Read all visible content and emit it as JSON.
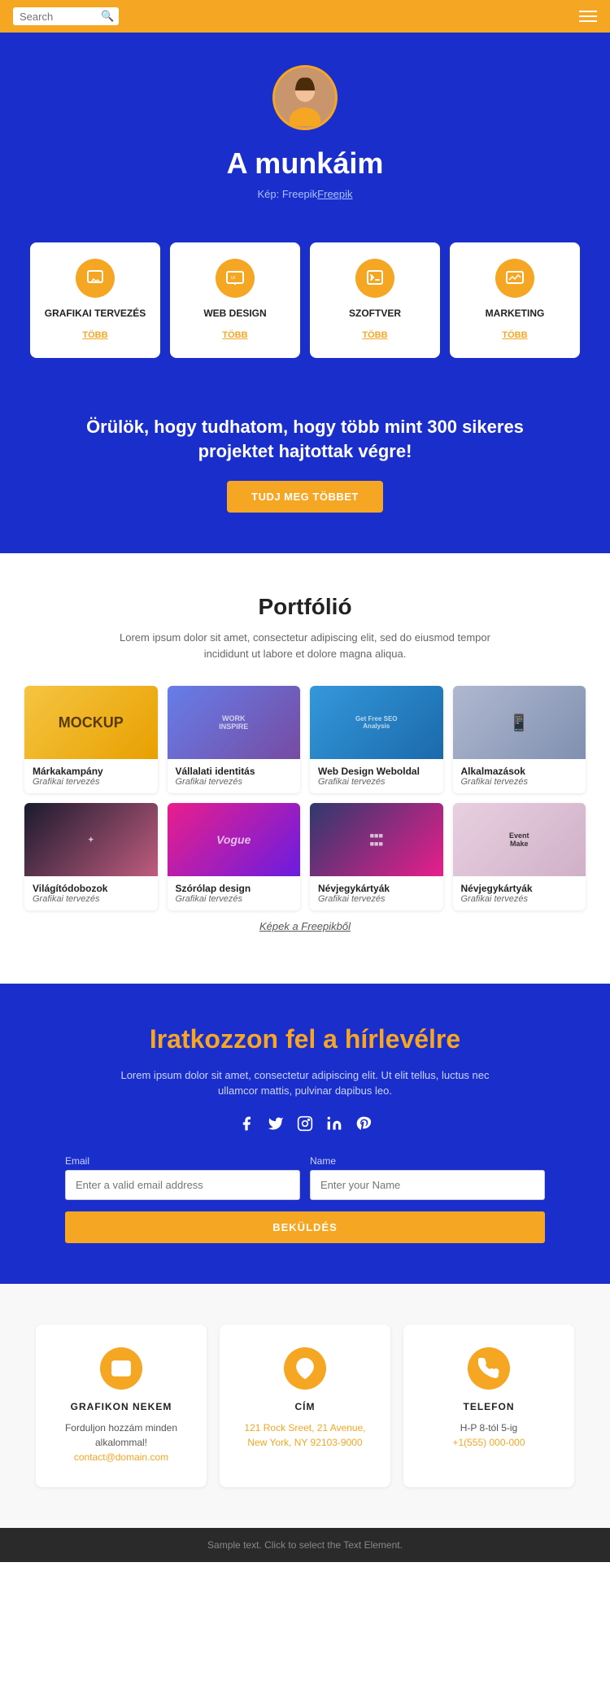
{
  "header": {
    "search_placeholder": "Search",
    "menu_label": "Menu"
  },
  "hero": {
    "title": "A munkáim",
    "image_credit": "Kép: Freepik",
    "image_credit_link": "Freepik"
  },
  "services": [
    {
      "id": "grafikai",
      "title": "GRAFIKAI TERVEZÉS",
      "more": "TÖBB"
    },
    {
      "id": "web",
      "title": "WEB DESIGN",
      "more": "TÖBB"
    },
    {
      "id": "szoftver",
      "title": "SZOFTVER",
      "more": "TÖBB"
    },
    {
      "id": "marketing",
      "title": "MARKETING",
      "more": "TÖBB"
    }
  ],
  "cta": {
    "text": "Örülök, hogy tudhatom, hogy több mint 300 sikeres projektet hajtottak végre!",
    "button_label": "TUDJ MEG TÖBBET"
  },
  "portfolio": {
    "title": "Portfólió",
    "description": "Lorem ipsum dolor sit amet, consectetur adipiscing elit, sed do eiusmod tempor incididunt ut labore et dolore magna aliqua.",
    "items": [
      {
        "title": "Márkakampány",
        "category": "Grafikai tervezés",
        "color_start": "#f5c542",
        "color_end": "#e8a000"
      },
      {
        "title": "Vállalati identitás",
        "category": "Grafikai tervezés",
        "color_start": "#667eea",
        "color_end": "#764ba2"
      },
      {
        "title": "Web Design Weboldal",
        "category": "Grafikai tervezés",
        "color_start": "#43e97b",
        "color_end": "#38f9d7"
      },
      {
        "title": "Alkalmazások",
        "category": "Grafikai tervezés",
        "color_start": "#c0c0d0",
        "color_end": "#a0a0c0"
      },
      {
        "title": "Világítódobozok",
        "category": "Grafikai tervezés",
        "color_start": "#2d3561",
        "color_end": "#c05c7e"
      },
      {
        "title": "Szórólap design",
        "category": "Grafikai tervezés",
        "color_start": "#e91e8c",
        "color_end": "#6a1de0"
      },
      {
        "title": "Névjegykártyák",
        "category": "Grafikai tervezés",
        "color_start": "#2d3a6d",
        "color_end": "#e91e8c"
      },
      {
        "title": "Névjegykártyák",
        "category": "Grafikai tervezés",
        "color_start": "#e91e8c",
        "color_end": "#c05c7e"
      }
    ],
    "source_text": "Képek a Freepikből",
    "source_link": "Freepikből"
  },
  "newsletter": {
    "title": "Iratkozzon fel a hírlevélre",
    "description": "Lorem ipsum dolor sit amet, consectetur adipiscing elit. Ut elit tellus, luctus nec ullamcor mattis, pulvinar dapibus leo.",
    "social": [
      {
        "icon": "f",
        "label": "Facebook"
      },
      {
        "icon": "t",
        "label": "Twitter"
      },
      {
        "icon": "ig",
        "label": "Instagram"
      },
      {
        "icon": "in",
        "label": "LinkedIn"
      },
      {
        "icon": "p",
        "label": "Pinterest"
      }
    ],
    "email_label": "Email",
    "email_placeholder": "Enter a valid email address",
    "name_label": "Name",
    "name_placeholder": "Enter your Name",
    "submit_label": "BEKÜLDÉS"
  },
  "contact": {
    "cards": [
      {
        "icon_type": "email",
        "title": "GRAFIKON NEKEM",
        "text": "Forduljon hozzám minden alkalommal!",
        "link_text": "contact@domain.com",
        "link_href": "mailto:contact@domain.com"
      },
      {
        "icon_type": "location",
        "title": "CÍM",
        "text": "121 Rock Sreet, 21 Avenue, New York, NY 92103-9000",
        "link_text": "",
        "link_href": ""
      },
      {
        "icon_type": "phone",
        "title": "TELEFON",
        "text": "H-P 8-tól 5-ig",
        "link_text": "+1(555) 000-000",
        "link_href": "tel:+15550000000"
      }
    ]
  },
  "footer": {
    "text": "Sample text. Click to select the Text Element."
  }
}
